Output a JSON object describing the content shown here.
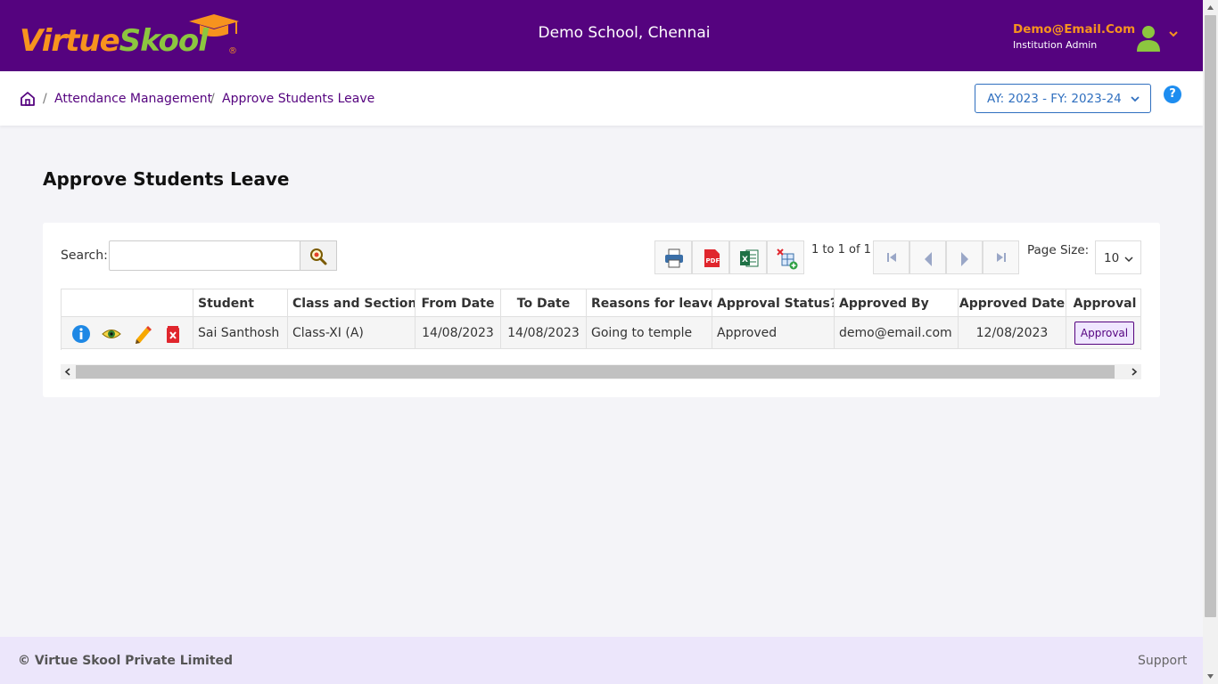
{
  "brand": {
    "logo_part1": "Virtue",
    "logo_part2": "Skool",
    "registered_mark": "®",
    "orange": "#f7931e",
    "green": "#8cc63f",
    "purple": "#55037f"
  },
  "header": {
    "school_name": "Demo School, Chennai",
    "user_email": "Demo@Email.Com",
    "user_role": "Institution Admin"
  },
  "breadcrumb": {
    "items": [
      "Attendance Management",
      "Approve Students Leave"
    ],
    "separator": "/"
  },
  "academic_year": "AY: 2023 - FY: 2023-24",
  "help_label": "?",
  "page": {
    "title": "Approve Students Leave"
  },
  "toolbar": {
    "search_label": "Search:",
    "search_value": "",
    "icons": [
      "print-icon",
      "pdf-icon",
      "excel-icon",
      "column-chooser-icon"
    ],
    "page_info": "1 to 1 of 1",
    "page_size_label": "Page Size:",
    "page_size": "10"
  },
  "table": {
    "columns": [
      "",
      "Student",
      "Class and Section",
      "From Date",
      "To Date",
      "Reasons for leave",
      "Approval Status?",
      "Approved By",
      "Approved Date",
      "Approval"
    ],
    "rows": [
      {
        "student": "Sai Santhosh",
        "class_section": "Class-XI (A)",
        "from_date": "14/08/2023",
        "to_date": "14/08/2023",
        "reason": "Going to temple",
        "status": "Approved",
        "approved_by": "demo@email.com",
        "approved_date": "12/08/2023",
        "action_label": "Approval"
      }
    ]
  },
  "footer": {
    "copyright": "© Virtue Skool Private Limited",
    "support": "Support"
  }
}
